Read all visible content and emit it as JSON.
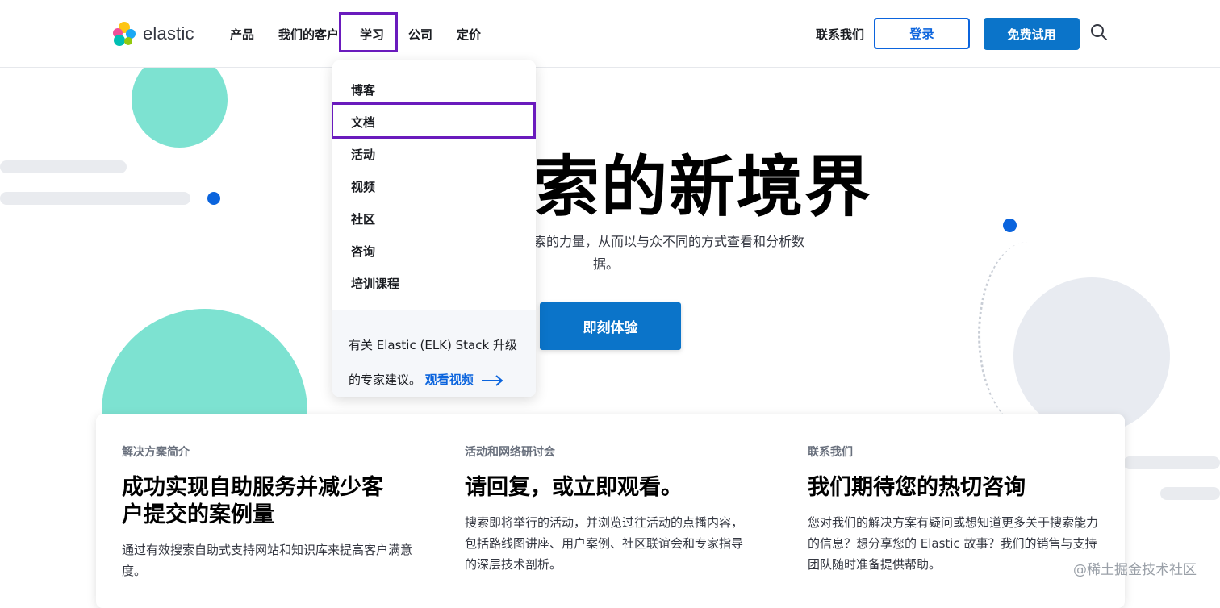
{
  "header": {
    "logo_text": "elastic",
    "nav": [
      {
        "label": "产品"
      },
      {
        "label": "我们的客户"
      },
      {
        "label": "学习"
      },
      {
        "label": "公司"
      },
      {
        "label": "定价"
      }
    ],
    "contact": "联系我们",
    "login": "登录",
    "trial": "免费试用"
  },
  "hero": {
    "title": "索的新境界",
    "subtitle_line1": "索的力量，从而以与众不同的方式查看和分析数",
    "subtitle_line2": "据。",
    "cta": "即刻体验"
  },
  "dropdown": {
    "items": [
      "博客",
      "文档",
      "活动",
      "视频",
      "社区",
      "咨询",
      "培训课程"
    ],
    "footer_text": "有关 Elastic (ELK) Stack 升级的专家建议。",
    "footer_link": "观看视频"
  },
  "cards": [
    {
      "eyebrow": "解决方案简介",
      "title": "成功实现自助服务并减少客户提交的案例量",
      "desc": "通过有效搜索自助式支持网站和知识库来提高客户满意度。"
    },
    {
      "eyebrow": "活动和网络研讨会",
      "title": "请回复，或立即观看。",
      "desc": "搜索即将举行的活动，并浏览过往活动的点播内容，包括路线图讲座、用户案例、社区联谊会和专家指导的深层技术剖析。"
    },
    {
      "eyebrow": "联系我们",
      "title": "我们期待您的热切咨询",
      "desc": "您对我们的解决方案有疑问或想知道更多关于搜索能力的信息？想分享您的 Elastic 故事？我们的销售与支持团队随时准备提供帮助。"
    }
  ],
  "watermark": "@稀土掘金技术社区",
  "colors": {
    "primary": "#0b74c9",
    "highlight": "#6a1bbd",
    "teal": "#7de2d1"
  }
}
